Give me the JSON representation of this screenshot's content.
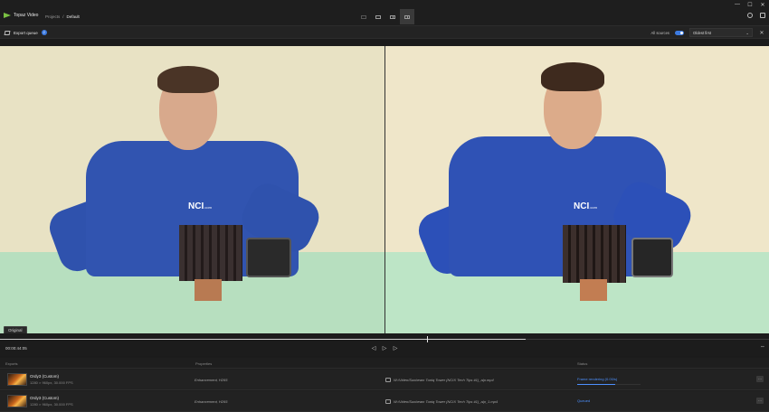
{
  "app": {
    "name": "Topaz Video",
    "breadcrumbs": [
      "Projects",
      "/",
      "Default"
    ]
  },
  "window_controls": [
    "—",
    "☐",
    "✕"
  ],
  "queue_bar": {
    "label": "Export queue",
    "count": "2",
    "sources_label": "All sources",
    "sources_enabled": true,
    "sort_value": "Oldest first"
  },
  "viewer": {
    "left_tag": "Original",
    "logo_text": "NCI",
    "logo_suffix": ".com"
  },
  "timeline": {
    "timecode": "00:00:44:05",
    "progress": 0.684,
    "marker": 0.555
  },
  "exports": {
    "headers": {
      "exports": "Exports",
      "properties": "Properties",
      "status": "Status"
    },
    "rows": [
      {
        "name": "Ordy3 (Custom)",
        "spec": "1280 × 960px, 30.000 FPS",
        "properties": "Enhancement, H265",
        "path": "W:/Video/Sunbeam Tuniq Tower (NCIX Tech Tips #1)_alp.mp4",
        "status": "Frame rendering (0.00/s)",
        "progress": 0.6
      },
      {
        "name": "Ordy3 (Custom)",
        "spec": "1280 × 960px, 30.000 FPS",
        "properties": "Enhancement, H265",
        "path": "W:/Video/Sunbeam Tuniq Tower (NCIX Tech Tips #1)_alp_1.mp4",
        "status": "Queued",
        "progress": 0
      }
    ]
  },
  "colors": {
    "accent": "#4d90fe",
    "brand": "#7ac143",
    "wall": "#efe6c9",
    "table": "#b9e3c2",
    "shirt": "#2f52b5"
  }
}
